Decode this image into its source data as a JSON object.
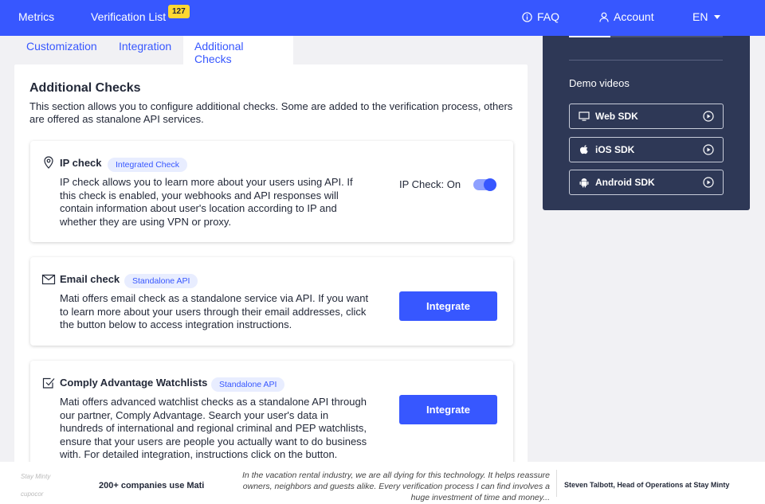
{
  "nav": {
    "metrics": "Metrics",
    "verification_list": "Verification List",
    "verification_count": "127",
    "faq": "FAQ",
    "account": "Account",
    "language": "EN"
  },
  "tabs": [
    {
      "label": "Customization"
    },
    {
      "label": "Integration"
    },
    {
      "label": "Additional Checks",
      "active": true
    }
  ],
  "section": {
    "title": "Additional Checks",
    "description": "This section allows you to configure additional checks. Some are added to the verification process, others are offered as stanalone API services."
  },
  "checks": [
    {
      "icon": "location-pin-icon",
      "title": "IP check",
      "tag": "Integrated Check",
      "description": "IP check allows you to learn more about your users using API. If this check is enabled, your webhooks and API responses will contain information about user's location according to IP and whether they are using VPN or proxy.",
      "toggle_label": "IP Check: On",
      "toggle_on": true
    },
    {
      "icon": "envelope-icon",
      "title": "Email check",
      "tag": "Standalone API",
      "description": "Mati offers email check as a standalone service via API. If you want to learn more about your users through their email addresses, click the button below to access integration instructions.",
      "button": "Integrate"
    },
    {
      "icon": "checkbox-icon",
      "title": "Comply Advantage Watchlists",
      "tag": "Standalone API",
      "description": "Mati offers advanced watchlist checks as a standalone API through our partner, Comply Advantage. Search your user's data in hundreds of international and regional criminal and PEP watchlists, ensure that your users are people you actually want to do business with. For detailed integration, instructions click on the button.",
      "button": "Integrate"
    }
  ],
  "sidebar": {
    "demo_title": "Demo videos",
    "sdks": [
      {
        "label": "Web SDK",
        "icon": "monitor-icon"
      },
      {
        "label": "iOS SDK",
        "icon": "apple-icon"
      },
      {
        "label": "Android SDK",
        "icon": "android-icon"
      }
    ]
  },
  "footer": {
    "logos": [
      "Stay Minty",
      "cupocor"
    ],
    "count_text": "200+ companies use Mati",
    "quote": "In the vacation rental industry, we are all dying for this technology. It helps reassure owners, neighbors and guests alike. Every verification process I can find involves a huge investment of time and money...",
    "author": "Steven Talbott, Head of Operations at Stay Minty"
  },
  "colors": {
    "brand_blue": "#3757ff",
    "badge_yellow": "#ffd731",
    "sidebar_navy": "#2e3856",
    "pill_bg": "#e8edff"
  }
}
